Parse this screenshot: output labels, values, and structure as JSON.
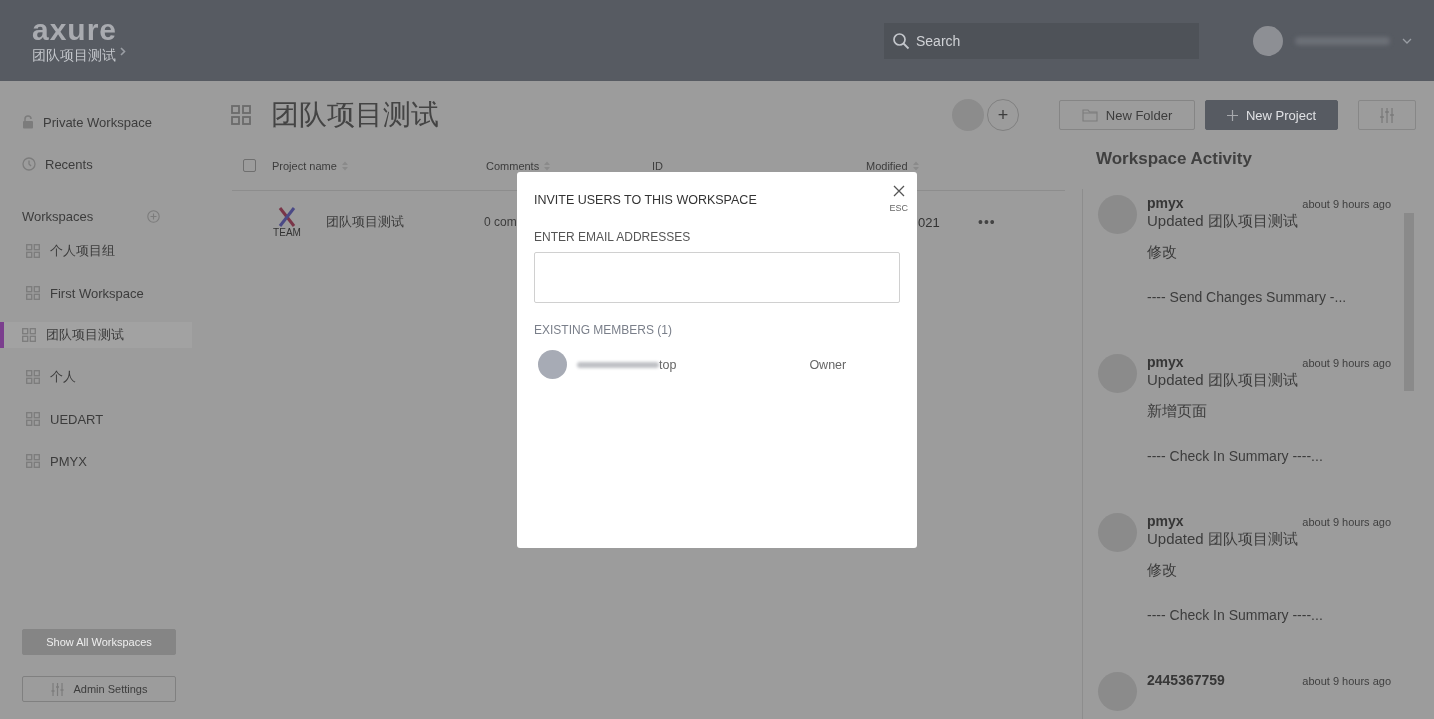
{
  "header": {
    "logo": "axure",
    "breadcrumb": "团队项目测试",
    "search": {
      "placeholder": "Search"
    }
  },
  "sidebar": {
    "top_items": [
      {
        "label": "Private Workspace"
      },
      {
        "label": "Recents"
      }
    ],
    "workspaces_heading": "Workspaces",
    "workspaces": [
      {
        "label": "个人项目组",
        "selected": false
      },
      {
        "label": "First Workspace",
        "selected": false
      },
      {
        "label": "团队项目测试",
        "selected": true
      },
      {
        "label": "个人",
        "selected": false
      },
      {
        "label": "UEDART",
        "selected": false
      },
      {
        "label": "PMYX",
        "selected": false
      }
    ],
    "show_all_button": "Show All Workspaces",
    "admin_button": "Admin Settings"
  },
  "page": {
    "title": "团队项目测试",
    "add_member_button": "+",
    "new_folder_button": "New Folder",
    "new_project_button": "New Project"
  },
  "table": {
    "select_all_checked": false,
    "columns": [
      {
        "label": "Project name",
        "sortable": true
      },
      {
        "label": "Comments",
        "sortable": true
      },
      {
        "label": "ID",
        "sortable": false
      },
      {
        "label": "Modified",
        "sortable": true
      }
    ],
    "rows": [
      {
        "badge": "TEAM",
        "name": "团队项目测试",
        "comments": "0 com",
        "modified": "021",
        "more": "•••"
      }
    ]
  },
  "activity": {
    "title": "Workspace Activity",
    "items": [
      {
        "user": "pmyx",
        "time": "about 9 hours ago",
        "action": "Updated 团队项目测试",
        "note": "修改",
        "summary": "---- Send Changes Summary -..."
      },
      {
        "user": "pmyx",
        "time": "about 9 hours ago",
        "action": "Updated 团队项目测试",
        "note": "新增页面",
        "summary": "---- Check In Summary ----..."
      },
      {
        "user": "pmyx",
        "time": "about 9 hours ago",
        "action": "Updated 团队项目测试",
        "note": "修改",
        "summary": "---- Check In Summary ----..."
      },
      {
        "user": "2445367759",
        "time": "about 9 hours ago"
      }
    ]
  },
  "dialog": {
    "title": "INVITE USERS TO THIS WORKSPACE",
    "close_hint": "ESC",
    "email_label": "ENTER EMAIL ADDRESSES",
    "members_heading": "EXISTING MEMBERS (1)",
    "members": [
      {
        "email_visible": "top",
        "role": "Owner"
      }
    ]
  }
}
